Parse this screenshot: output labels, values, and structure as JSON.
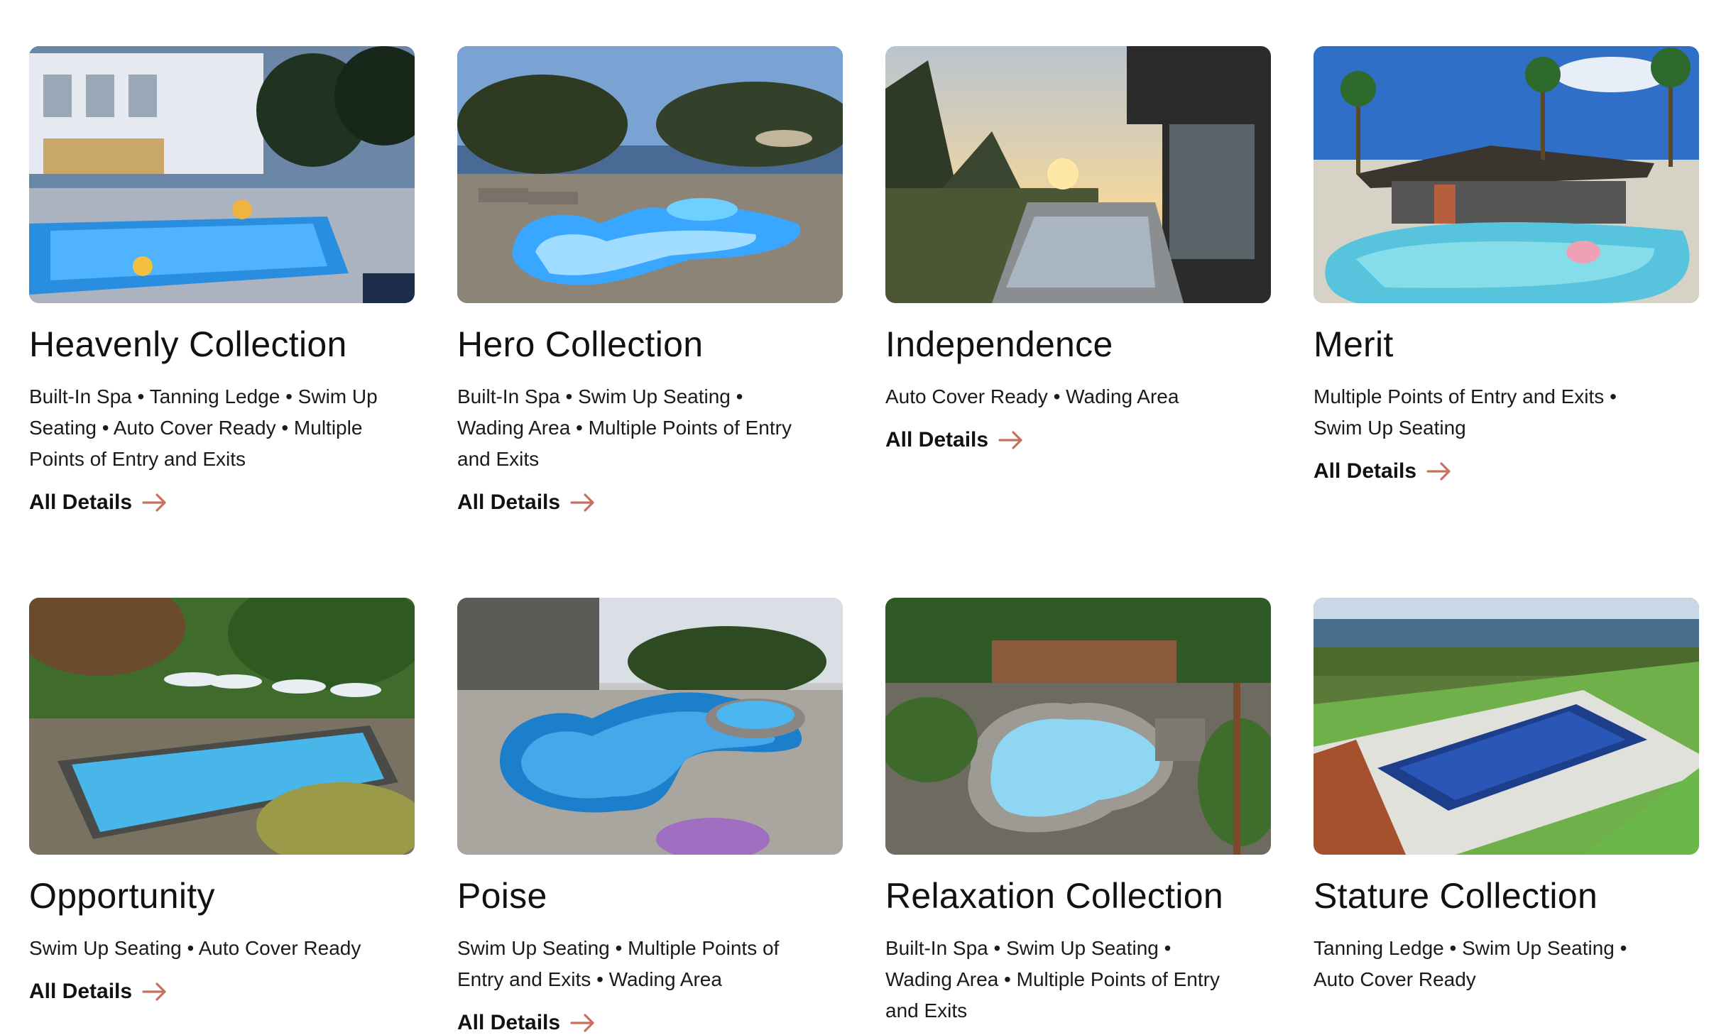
{
  "cards": [
    {
      "title": "Heavenly Collection",
      "features": "Built-In Spa • Tanning Ledge • Swim Up Seating • Auto Cover Ready • Multiple Points of Entry and Exits",
      "link": "All Details"
    },
    {
      "title": "Hero Collection",
      "features": "Built-In Spa • Swim Up Seating • Wading Area • Multiple Points of Entry and Exits",
      "link": "All Details"
    },
    {
      "title": "Independence",
      "features": "Auto Cover Ready • Wading Area",
      "link": "All Details"
    },
    {
      "title": "Merit",
      "features": "Multiple Points of Entry and Exits • Swim Up Seating",
      "link": "All Details"
    },
    {
      "title": "Opportunity",
      "features": "Swim Up Seating • Auto Cover Ready",
      "link": "All Details"
    },
    {
      "title": "Poise",
      "features": "Swim Up Seating • Multiple Points of Entry and Exits • Wading Area",
      "link": "All Details"
    },
    {
      "title": "Relaxation Collection",
      "features": "Built-In Spa • Swim Up Seating • Wading Area • Multiple Points of Entry and Exits",
      "link": ""
    },
    {
      "title": "Stature Collection",
      "features": "Tanning Ledge • Swim Up Seating • Auto Cover Ready",
      "link": ""
    }
  ],
  "colors": {
    "accent_arrow": "#c8705f"
  }
}
